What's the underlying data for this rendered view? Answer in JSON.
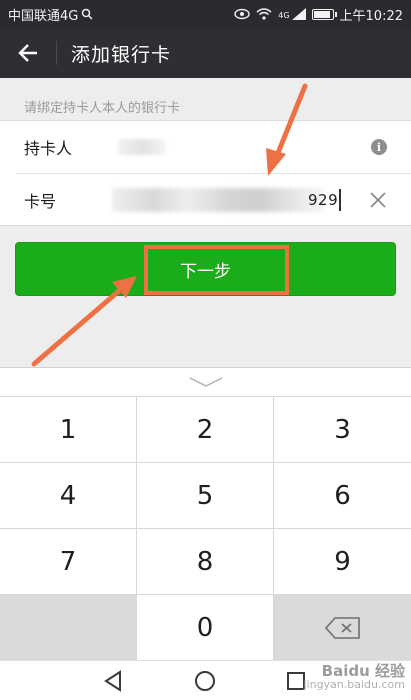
{
  "status_bar": {
    "carrier": "中国联通4G",
    "network_label": "4G",
    "time": "上午10:22"
  },
  "header": {
    "back_icon": "arrow-left-icon",
    "title": "添加银行卡"
  },
  "form": {
    "hint": "请绑定持卡人本人的银行卡",
    "holder_label": "持卡人",
    "card_label": "卡号",
    "card_number_visible_tail": "929",
    "info_icon": "info-icon",
    "clear_icon": "close-icon"
  },
  "next_button": {
    "label": "下一步"
  },
  "keyboard": {
    "toggle_icon": "chevron-down-icon",
    "keys": [
      "1",
      "2",
      "3",
      "4",
      "5",
      "6",
      "7",
      "8",
      "9",
      "",
      "0",
      ""
    ],
    "backspace_icon": "backspace-icon"
  },
  "nav_bar": {
    "back_icon": "nav-back-icon",
    "home_icon": "nav-home-icon",
    "recents_icon": "nav-recents-icon"
  },
  "watermark": {
    "brand": "Baidu 经验",
    "url": "jingyan.baidu.com"
  },
  "colors": {
    "primary_green": "#1aad19",
    "header_bg": "#2e2e33",
    "annotation_orange": "#ee7145"
  }
}
